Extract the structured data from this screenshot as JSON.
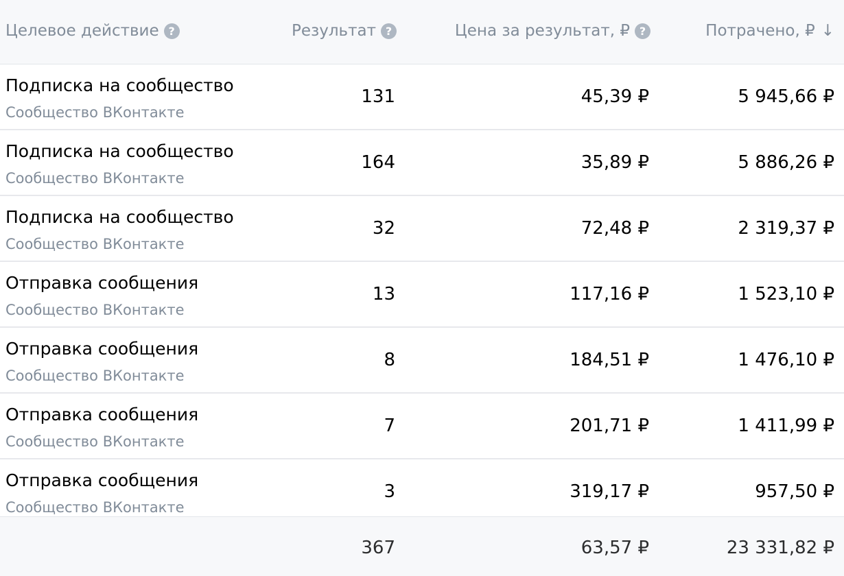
{
  "header": {
    "col_action": "Целевое действие",
    "col_result": "Результат",
    "col_price": "Цена за результат, ₽",
    "col_spent": "Потрачено, ₽",
    "help_glyph": "?",
    "sort_glyph": "↓"
  },
  "rows": [
    {
      "title": "Подписка на сообщество",
      "subtitle": "Сообщество ВКонтакте",
      "result": "131",
      "price": "45,39 ₽",
      "spent": "5 945,66 ₽"
    },
    {
      "title": "Подписка на сообщество",
      "subtitle": "Сообщество ВКонтакте",
      "result": "164",
      "price": "35,89 ₽",
      "spent": "5 886,26 ₽"
    },
    {
      "title": "Подписка на сообщество",
      "subtitle": "Сообщество ВКонтакте",
      "result": "32",
      "price": "72,48 ₽",
      "spent": "2 319,37 ₽"
    },
    {
      "title": "Отправка сообщения",
      "subtitle": "Сообщество ВКонтакте",
      "result": "13",
      "price": "117,16 ₽",
      "spent": "1 523,10 ₽"
    },
    {
      "title": "Отправка сообщения",
      "subtitle": "Сообщество ВКонтакте",
      "result": "8",
      "price": "184,51 ₽",
      "spent": "1 476,10 ₽"
    },
    {
      "title": "Отправка сообщения",
      "subtitle": "Сообщество ВКонтакте",
      "result": "7",
      "price": "201,71 ₽",
      "spent": "1 411,99 ₽"
    },
    {
      "title": "Отправка сообщения",
      "subtitle": "Сообщество ВКонтакте",
      "result": "3",
      "price": "319,17 ₽",
      "spent": "957,50 ₽"
    }
  ],
  "totals": {
    "result": "367",
    "price": "63,57 ₽",
    "spent": "23 331,82 ₽"
  }
}
